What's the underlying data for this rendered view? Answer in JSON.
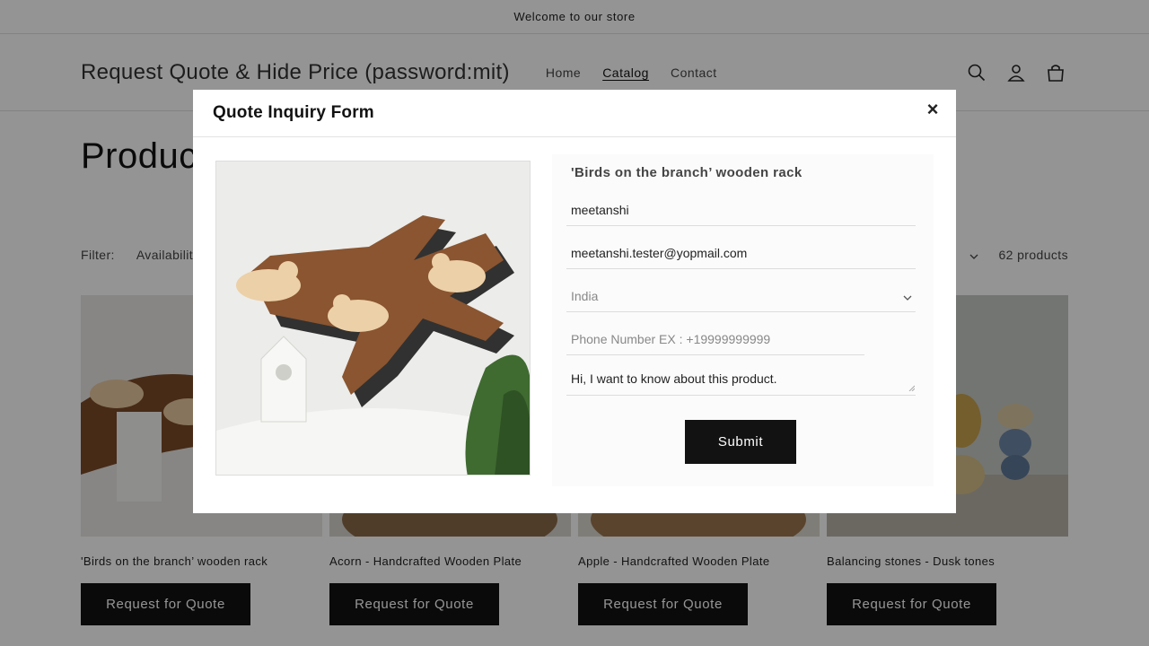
{
  "announcement": "Welcome to our store",
  "header": {
    "store_name": "Request Quote & Hide Price (password:mit)",
    "nav": [
      "Home",
      "Catalog",
      "Contact"
    ],
    "active_nav": "Catalog",
    "icons": [
      "search-icon",
      "account-icon",
      "cart-icon"
    ]
  },
  "page": {
    "title": "Products",
    "filter_label": "Filter:",
    "filter_availability": "Availability",
    "product_count": "62 products"
  },
  "products": [
    {
      "title": "'Birds on the branch’ wooden rack",
      "button": "Request for Quote"
    },
    {
      "title": "Acorn - Handcrafted Wooden Plate",
      "button": "Request for Quote"
    },
    {
      "title": "Apple - Handcrafted Wooden Plate",
      "button": "Request for Quote"
    },
    {
      "title": "Balancing stones - Dusk tones",
      "button": "Request for Quote"
    }
  ],
  "modal": {
    "title": "Quote Inquiry Form",
    "close": "×",
    "product_name": "'Birds on the branch’ wooden rack",
    "name_value": "meetanshi",
    "email_value": "meetanshi.tester@yopmail.com",
    "country_value": "India",
    "phone_placeholder": "Phone Number EX : +19999999999",
    "message_value": "Hi, I want to know about this product.",
    "submit_label": "Submit"
  },
  "colors": {
    "button_bg": "#121212",
    "overlay": "rgba(0,0,0,0.42)"
  }
}
